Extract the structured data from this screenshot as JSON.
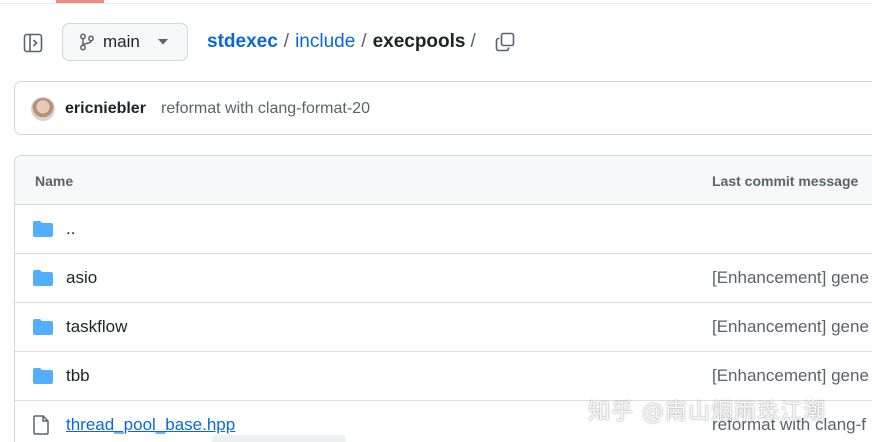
{
  "header": {
    "branch": "main",
    "breadcrumb": {
      "repo": "stdexec",
      "sep1": "/",
      "folder": "include",
      "sep2": "/",
      "current": "execpools",
      "sep3": "/"
    }
  },
  "latest_commit": {
    "author": "ericniebler",
    "message": "reformat with clang-format-20"
  },
  "table": {
    "headers": {
      "name": "Name",
      "last_commit": "Last commit message"
    },
    "rows": [
      {
        "type": "folder",
        "name": "..",
        "message": ""
      },
      {
        "type": "folder",
        "name": "asio",
        "message": "[Enhancement] gene"
      },
      {
        "type": "folder",
        "name": "taskflow",
        "message": "[Enhancement] gene"
      },
      {
        "type": "folder",
        "name": "tbb",
        "message": "[Enhancement] gene"
      },
      {
        "type": "file",
        "name": "thread_pool_base.hpp",
        "message": "reformat with clang-f"
      }
    ]
  },
  "watermark": "知乎 @南山烟雨珠江潮",
  "icons": [
    "sidebar-toggle-icon",
    "git-branch-icon",
    "caret-down-icon",
    "copy-icon",
    "folder-icon",
    "file-icon"
  ],
  "colors": {
    "link": "#0969da",
    "folder": "#54aeff",
    "muted": "#59636e",
    "border": "#d0d7de"
  }
}
